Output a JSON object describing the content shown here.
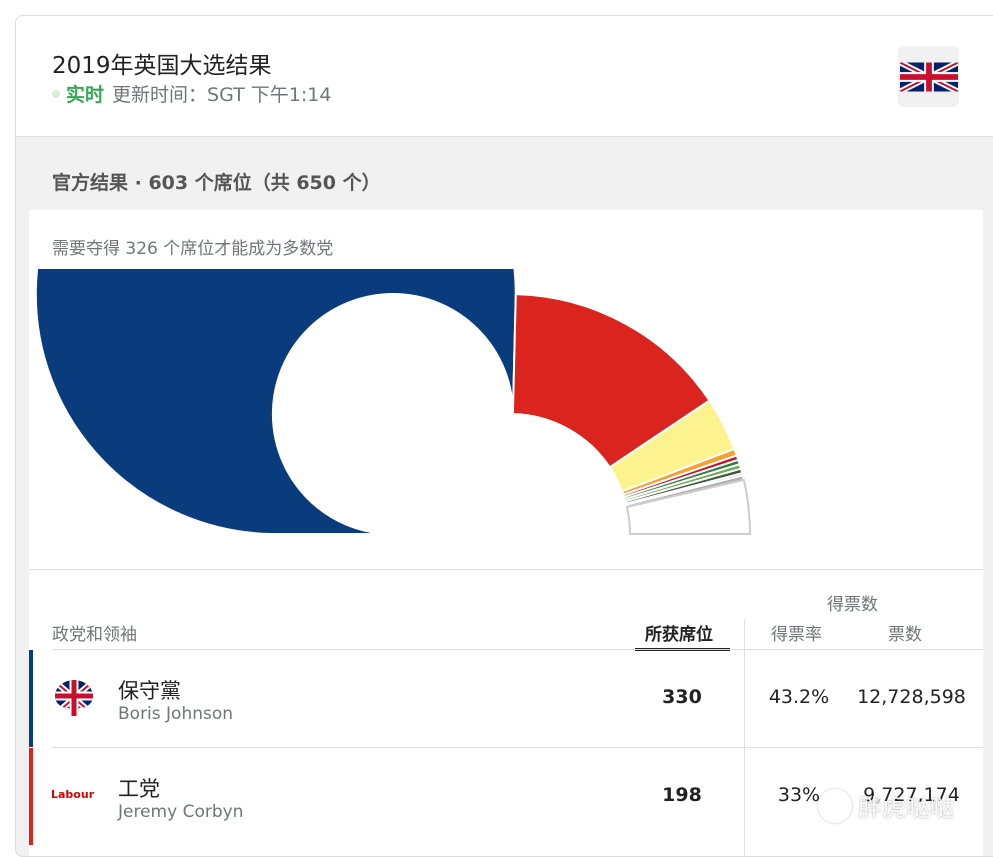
{
  "header": {
    "title": "2019年英国大选结果",
    "live_label": "实时",
    "updated_text": "更新时间：SGT 下午1:14",
    "flag_icon": "uk-flag-icon"
  },
  "summary": {
    "title": "官方结果 · 603 个席位（共 650 个）",
    "majority_text": "需要夺得 326 个席位才能成为多数党"
  },
  "chart_data": {
    "type": "pie",
    "total_seats": 650,
    "declared_seats": 603,
    "segments": [
      {
        "party": "保守黨",
        "seats": 330,
        "color": "#0a3b7c"
      },
      {
        "party": "工党",
        "seats": 198,
        "color": "#dc241f"
      },
      {
        "party": "",
        "seats": 47,
        "color": "#fdf38e"
      },
      {
        "party": "",
        "seats": 6,
        "color": "#f6a02d"
      },
      {
        "party": "",
        "seats": 4,
        "color": "#c8102e"
      },
      {
        "party": "",
        "seats": 4,
        "color": "#2e7d32"
      },
      {
        "party": "",
        "seats": 4,
        "color": "#6aa84f"
      },
      {
        "party": "",
        "seats": 4,
        "color": "#3d5a3d"
      },
      {
        "party": "",
        "seats": 2,
        "color": "#8e8e8e"
      },
      {
        "party": "",
        "seats": 4,
        "color": "#b0b0b0"
      }
    ],
    "undeclared_seats": 47,
    "undeclared_color": "#ffffff"
  },
  "table": {
    "headers": {
      "party_leader": "政党和领袖",
      "seats": "所获席位",
      "votes_group": "得票数",
      "share": "得票率",
      "votes": "票数"
    },
    "rows": [
      {
        "party": "保守黨",
        "leader": "Boris Johnson",
        "seats": "330",
        "share": "43.2%",
        "votes": "12,728,598",
        "color": "#0a3b7c",
        "logo": "conservative-tree-icon"
      },
      {
        "party": "工党",
        "leader": "Jeremy Corbyn",
        "seats": "198",
        "share": "33%",
        "votes": "9,727,174",
        "color": "#dc241f",
        "logo_text": "Labour"
      }
    ]
  },
  "watermark": "胖虎哒哒"
}
